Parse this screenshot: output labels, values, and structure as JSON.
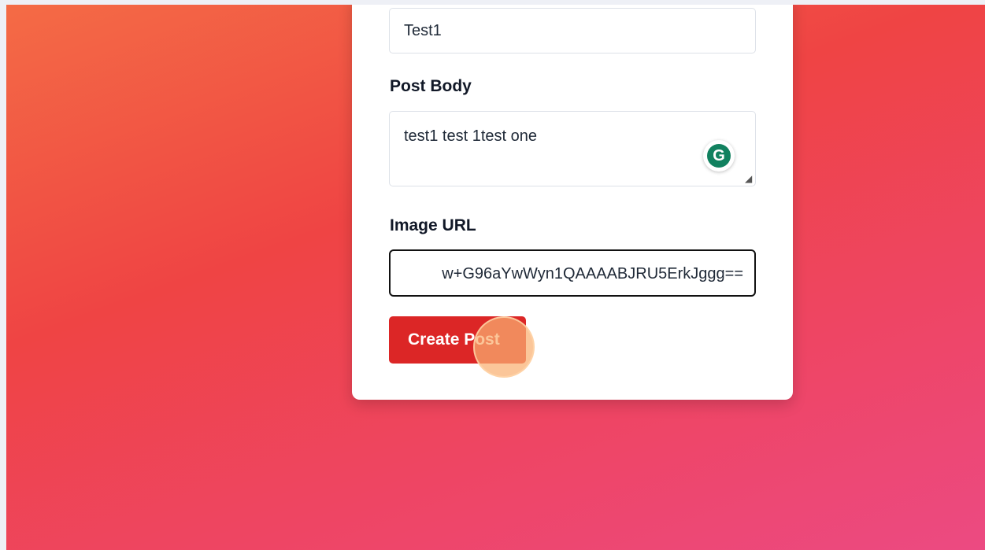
{
  "form": {
    "title_value": "Test1",
    "body_label": "Post Body",
    "body_value": "test1 test 1test one",
    "grammarly_letter": "G",
    "url_label": "Image URL",
    "url_value": "w+G96aYwWyn1QAAAABJRU5ErkJggg==",
    "submit_label": "Create Post"
  },
  "colors": {
    "accent": "#dc2626",
    "grammarly": "#11815f",
    "gradient_start": "#f46b45",
    "gradient_end": "#ec4a82"
  },
  "icons": {
    "grammarly": "grammarly-icon",
    "resize": "resize-handle-icon"
  }
}
